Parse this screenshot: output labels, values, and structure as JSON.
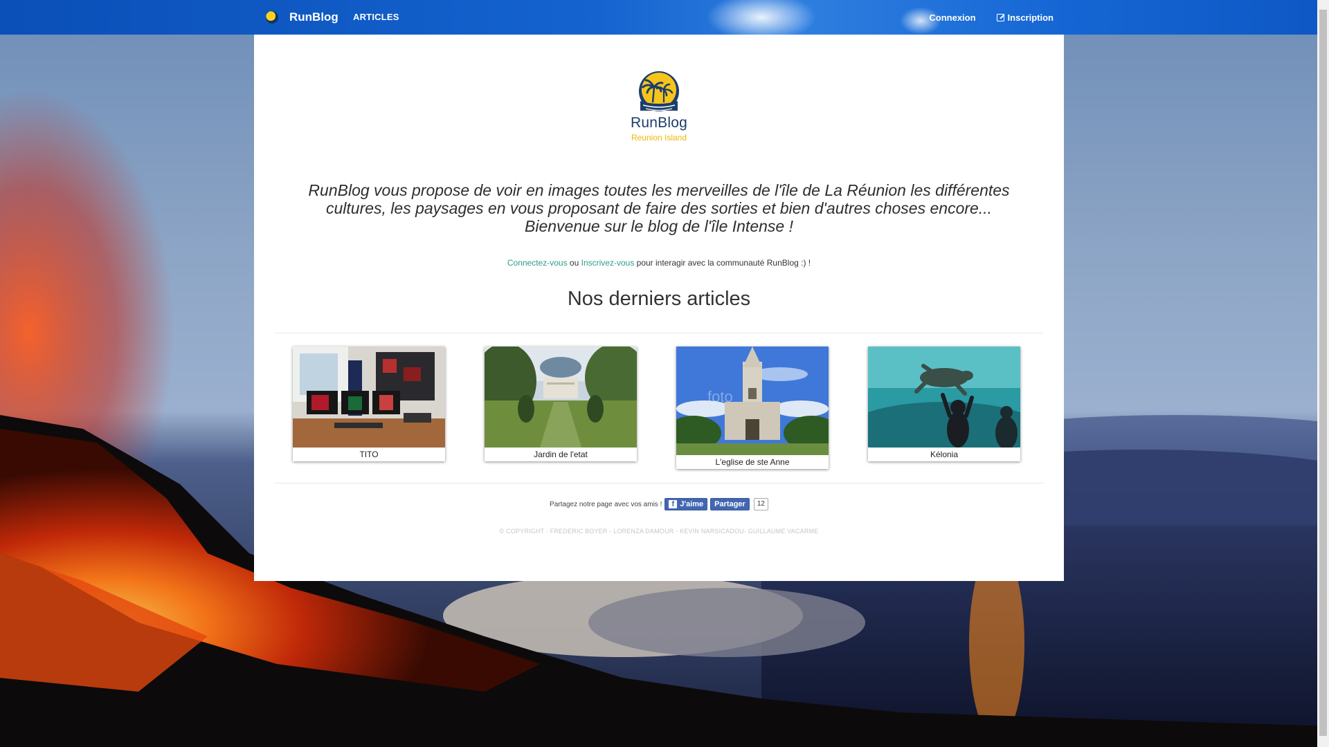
{
  "navbar": {
    "brand": "RunBlog",
    "articles_label": "ARTICLES",
    "login_label": "Connexion",
    "signup_label": "Inscription"
  },
  "logo": {
    "name": "RunBlog",
    "subtitle": "Reunion Island"
  },
  "intro_text": "RunBlog vous propose de voir en images toutes les merveilles de l'île de La Réunion les différentes cultures, les paysages en vous proposant de faire des sorties et bien d'autres choses encore... Bienvenue sur le blog de l'île Intense !",
  "connect": {
    "login_link": "Connectez-vous",
    "or": "ou",
    "signup_link": "Inscrivez-vous",
    "rest": "pour interagir avec la communauté RunBlog :) !"
  },
  "section_title": "Nos derniers articles",
  "articles": [
    {
      "title": "TITO"
    },
    {
      "title": "Jardin de l'etat"
    },
    {
      "title": "L'eglise de ste Anne"
    },
    {
      "title": "Kélonia"
    }
  ],
  "share": {
    "text": "Partagez notre page avec vos amis !",
    "like_label": "J'aime",
    "share_label": "Partager",
    "count": "12"
  },
  "copyright": "© COPYRIGHT · FREDERIC BOYER - LORENZA DAMOUR - KEVIN NARSICADOU- GUILLAUME VACARME",
  "colors": {
    "navbar": "#1463cf",
    "link_green": "#2a9c88",
    "logo_blue": "#1d3d6b",
    "logo_yellow": "#f2b600",
    "facebook": "#4267b2"
  }
}
